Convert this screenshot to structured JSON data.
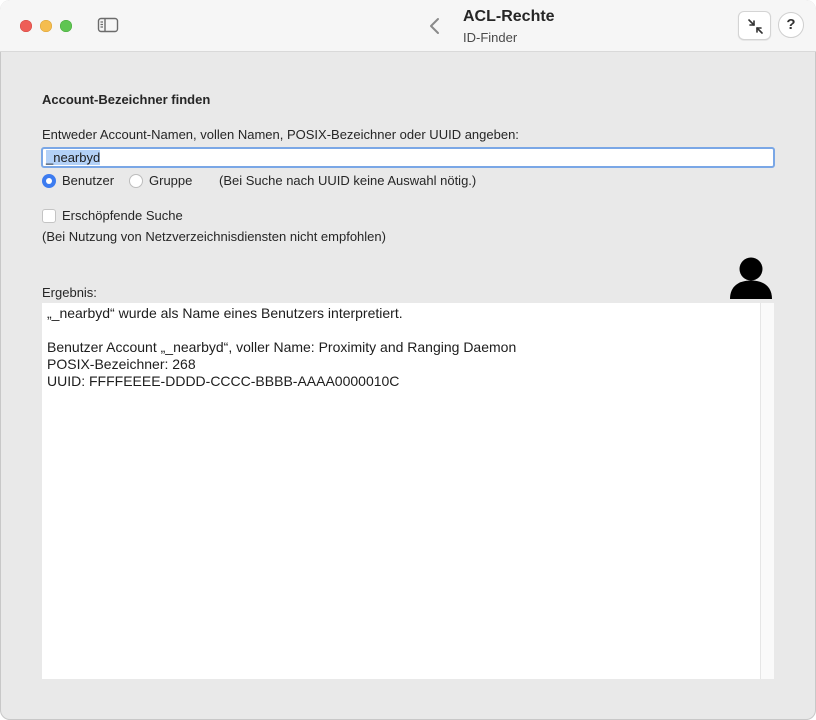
{
  "window": {
    "title": "ACL-Rechte",
    "subtitle": "ID-Finder",
    "help_label": "?"
  },
  "icons": {
    "sidebar_toggle": "sidebar-icon",
    "back": "chevron-left-icon",
    "collapse": "arrows-collapse-icon",
    "avatar": "person-icon"
  },
  "colors": {
    "accent": "#3d7cf0",
    "selection": "#b3d1f7",
    "close": "#ee5e57",
    "minimize": "#f5bd4f",
    "zoom": "#5fc552"
  },
  "form": {
    "heading": "Account-Bezeichner finden",
    "prompt": "Entweder Account-Namen, vollen Namen, POSIX-Bezeichner oder UUID angeben:",
    "search_value": "_nearbyd",
    "radio_user": "Benutzer",
    "radio_group": "Gruppe",
    "radio_selected": "Benutzer",
    "radio_hint": "(Bei Suche nach UUID keine Auswahl nötig.)",
    "exhaustive_label": "Erschöpfende Suche",
    "exhaustive_checked": false,
    "exhaustive_hint": "(Bei Nutzung von Netzverzeichnisdiensten nicht empfohlen)"
  },
  "result": {
    "label": "Ergebnis:",
    "lines": [
      "„_nearbyd“ wurde als Name eines Benutzers interpretiert.",
      "",
      "Benutzer Account „_nearbyd“, voller Name: Proximity and Ranging Daemon",
      "POSIX-Bezeichner: 268",
      "UUID: FFFFEEEE-DDDD-CCCC-BBBB-AAAA0000010C"
    ]
  }
}
